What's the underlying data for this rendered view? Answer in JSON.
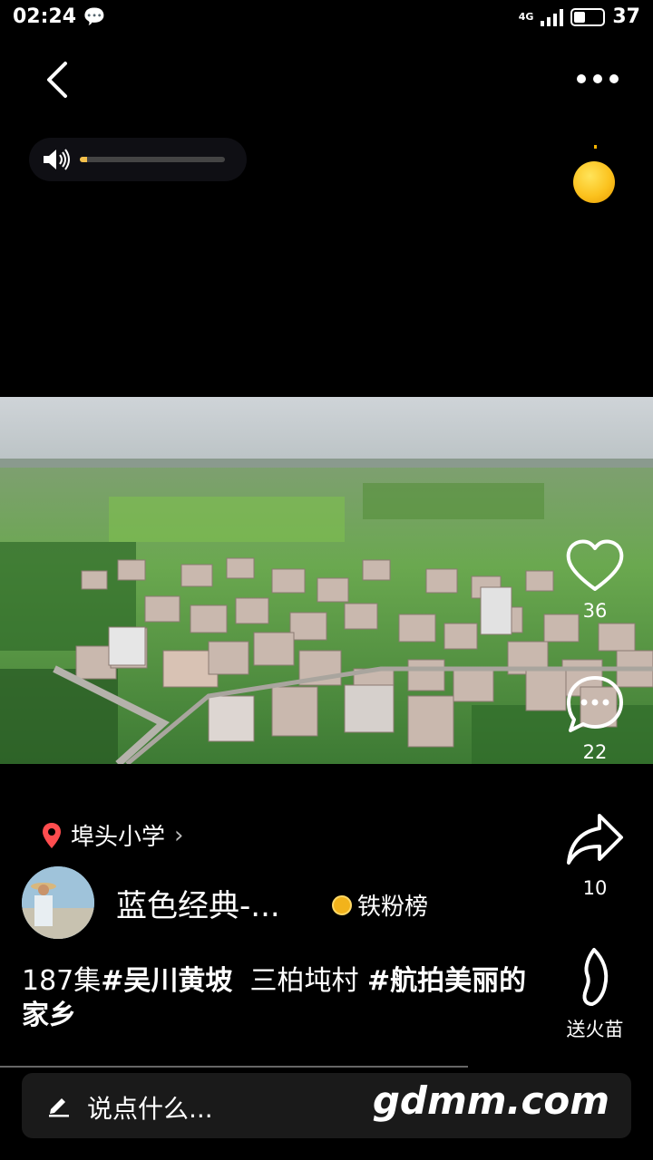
{
  "status_bar": {
    "time": "02:24",
    "network": "4G",
    "battery": "37"
  },
  "volume": {
    "level": 0.05
  },
  "actions": {
    "like_count": "36",
    "comment_count": "22",
    "share_count": "10",
    "fire_label": "送火苗"
  },
  "location": {
    "name": "埠头小学"
  },
  "author": {
    "name": "蓝色经典-...",
    "fans_badge": "铁粉榜"
  },
  "caption": {
    "prefix": "187集",
    "tag1": "#吴川黄坡",
    "middle": "三柏坉村",
    "tag2": "#航拍美丽的家乡"
  },
  "comment_bar": {
    "placeholder": "说点什么..."
  },
  "watermark": "gdmm.com",
  "colors": {
    "accent_yellow": "#f5c04b",
    "background": "#000000",
    "pin_red": "#ff4d4f"
  }
}
